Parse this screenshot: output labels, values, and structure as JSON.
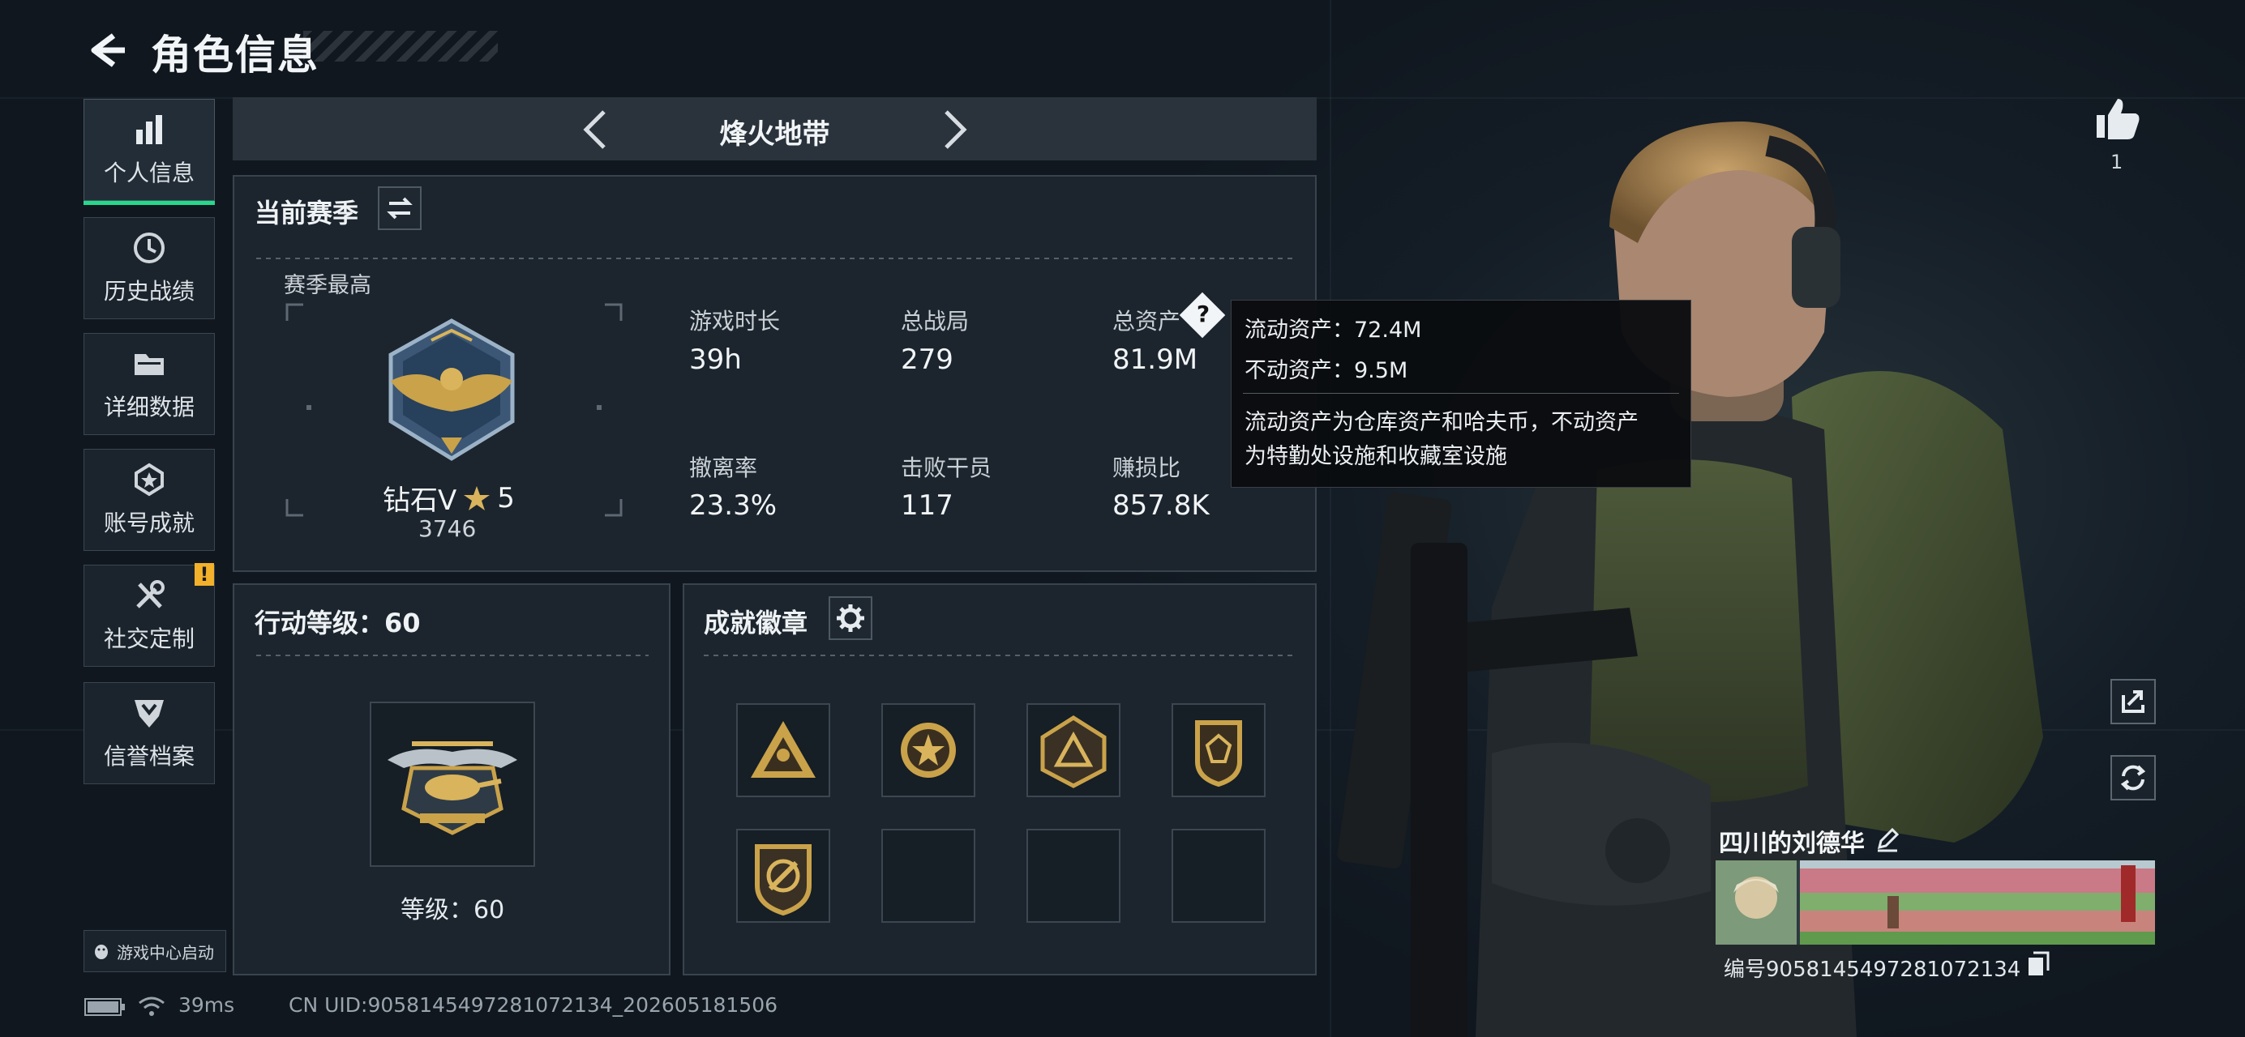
{
  "header": {
    "title": "角色信息"
  },
  "sidebar": {
    "items": [
      {
        "label": "个人信息",
        "icon": "bar-chart-icon",
        "active": true
      },
      {
        "label": "历史战绩",
        "icon": "clock-history-icon",
        "active": false
      },
      {
        "label": "详细数据",
        "icon": "folder-icon",
        "active": false
      },
      {
        "label": "账号成就",
        "icon": "medal-icon",
        "active": false
      },
      {
        "label": "社交定制",
        "icon": "tools-icon",
        "active": false,
        "badge": "!"
      },
      {
        "label": "信誉档案",
        "icon": "shield-rank-icon",
        "active": false
      }
    ],
    "launcher": "游戏中心启动"
  },
  "mode": {
    "title": "烽火地带"
  },
  "season": {
    "title": "当前赛季",
    "best_label": "赛季最高",
    "rank_name": "钻石V",
    "rank_stars": "5",
    "rank_score": "3746",
    "stats": [
      {
        "label": "游戏时长",
        "value": "39h"
      },
      {
        "label": "总战局",
        "value": "279"
      },
      {
        "label": "总资产",
        "value": "81.9M"
      },
      {
        "label": "撤离率",
        "value": "23.3%"
      },
      {
        "label": "击败干员",
        "value": "117"
      },
      {
        "label": "赚损比",
        "value": "857.8K"
      }
    ]
  },
  "tooltip": {
    "line1": "流动资产：72.4M",
    "line2": "不动资产：9.5M",
    "desc1": "流动资产为仓库资产和哈夫币，不动资产",
    "desc2": "为特勤处设施和收藏室设施"
  },
  "action_level": {
    "title": "行动等级：60",
    "caption": "等级：60"
  },
  "badges": {
    "title": "成就徽章"
  },
  "profile": {
    "likes": "1",
    "name": "四川的刘德华",
    "id_text": "编号9058145497281072134"
  },
  "status_bar": {
    "ping": "39ms",
    "uid": "CN UID:9058145497281072134_202605181506"
  },
  "colors": {
    "accent": "#25d98b",
    "warning": "#f2b02b",
    "gold": "#c9a24a"
  }
}
